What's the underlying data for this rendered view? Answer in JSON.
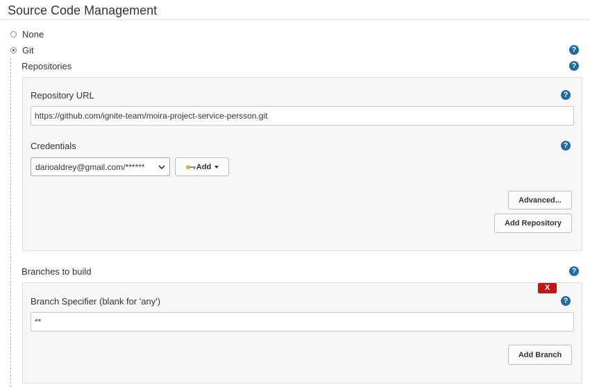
{
  "section": {
    "title": "Source Code Management"
  },
  "scm_options": [
    {
      "label": "None",
      "selected": false
    },
    {
      "label": "Git",
      "selected": true
    }
  ],
  "repositories": {
    "label": "Repositories",
    "url_label": "Repository URL",
    "url_value": "https://github.com/ignite-team/moira-project-service-persson.git",
    "credentials_label": "Credentials",
    "credentials_value": "darioaldrey@gmail.com/******",
    "add_label": "Add",
    "advanced_label": "Advanced...",
    "add_repository_label": "Add Repository"
  },
  "branches": {
    "label": "Branches to build",
    "delete_label": "X",
    "specifier_label": "Branch Specifier (blank for 'any')",
    "specifier_value": "**",
    "add_branch_label": "Add Branch"
  },
  "help_icon_glyph": "?",
  "colors": {
    "help_icon": "#1f6aa5",
    "delete_button": "#c41414"
  }
}
